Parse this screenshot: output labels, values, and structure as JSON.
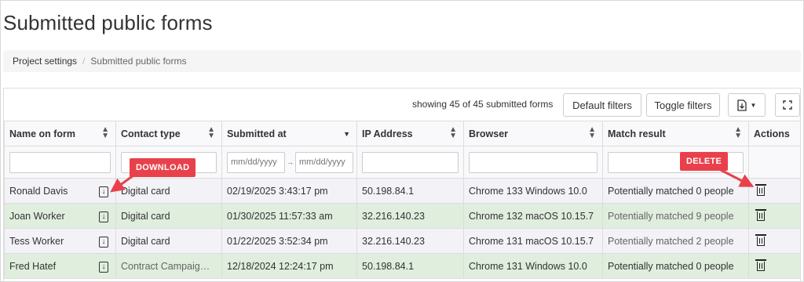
{
  "page": {
    "title": "Submitted public forms"
  },
  "breadcrumb": {
    "items": [
      "Project settings",
      "Submitted public forms"
    ],
    "separator": "/"
  },
  "toolbar": {
    "count_text": "showing 45 of 45 submitted forms",
    "default_filters_label": "Default filters",
    "toggle_filters_label": "Toggle filters",
    "export_icon": "download-file-icon",
    "fullscreen_icon": "expand-icon"
  },
  "table": {
    "columns": [
      "Name on form",
      "Contact type",
      "Submitted at",
      "IP Address",
      "Browser",
      "Match result",
      "Actions"
    ],
    "date_placeholder": "mm/dd/yyyy",
    "rows": [
      {
        "name": "Ronald Davis",
        "contact_type": "Digital card",
        "submitted_at": "02/19/2025 3:43:17 pm",
        "ip": "50.198.84.1",
        "browser": "Chrome 133 Windows 10.0",
        "match": "Potentially matched 0 people"
      },
      {
        "name": "Joan Worker",
        "contact_type": "Digital card",
        "submitted_at": "01/30/2025 11:57:33 am",
        "ip": "32.216.140.23",
        "browser": "Chrome 132 macOS 10.15.7",
        "match": "Potentially matched 9 people"
      },
      {
        "name": "Tess Worker",
        "contact_type": "Digital card",
        "submitted_at": "01/22/2025 3:52:34 pm",
        "ip": "32.216.140.23",
        "browser": "Chrome 131 macOS 10.15.7",
        "match": "Potentially matched 2 people"
      },
      {
        "name": "Fred Hatef",
        "contact_type": "Contract Campaig…",
        "submitted_at": "12/18/2024 12:24:17 pm",
        "ip": "50.198.84.1",
        "browser": "Chrome 131 Windows 10.0",
        "match": "Potentially matched 0 people"
      }
    ]
  },
  "annotations": {
    "download_label": "DOWNLOAD",
    "delete_label": "DELETE",
    "color": "#e9414b"
  },
  "colors": {
    "row_odd": "#f2f2f7",
    "row_even": "#dfeedd"
  }
}
